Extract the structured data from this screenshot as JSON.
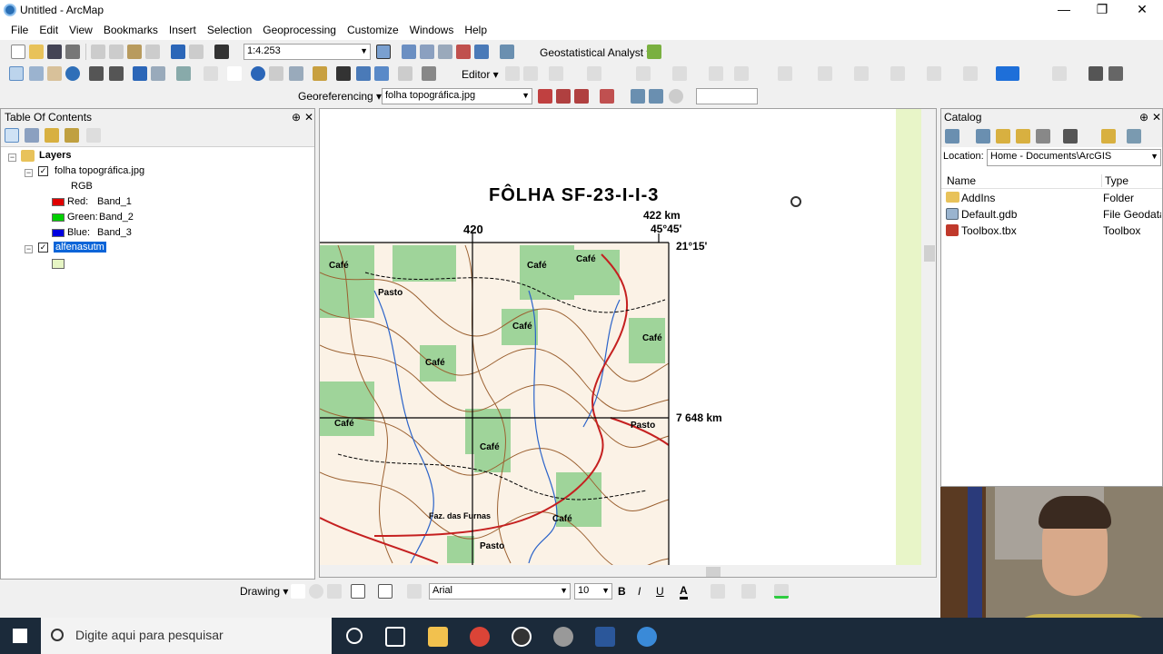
{
  "window": {
    "title": "Untitled - ArcMap",
    "minimize": "—",
    "restore": "❐",
    "close": "✕"
  },
  "menu": [
    "File",
    "Edit",
    "View",
    "Bookmarks",
    "Insert",
    "Selection",
    "Geoprocessing",
    "Customize",
    "Windows",
    "Help"
  ],
  "toolbar": {
    "scale": "1:4.253",
    "geostat": "Geostatistical Analyst ▾",
    "editor": "Editor ▾",
    "georef": "Georeferencing ▾",
    "georef_layer": "folha topográfica.jpg"
  },
  "toc": {
    "title": "Table Of Contents",
    "pin": "⊕",
    "close": "✕",
    "layers_label": "Layers",
    "raster_layer": "folha topográfica.jpg",
    "rgb": "RGB",
    "bands": [
      {
        "label": "Red:",
        "band": "Band_1",
        "color": "#e00000"
      },
      {
        "label": "Green:",
        "band": "Band_2",
        "color": "#00d000"
      },
      {
        "label": "Blue:",
        "band": "Band_3",
        "color": "#0000e0"
      }
    ],
    "vector_layer": "alfenasutm",
    "vector_color": "#e6f5c4"
  },
  "map": {
    "title": "FÔLHA SF-23-I-I-3",
    "easting_420": "420",
    "easting_422": "422 km",
    "lon": "45°45'",
    "lat": "21°15'",
    "northing": "7 648 km",
    "labels": [
      "Café",
      "Pasto",
      "Café",
      "Café",
      "Café",
      "Café",
      "Café",
      "Pasto",
      "Café",
      "Café",
      "Pasto",
      "Faz. das Furnas",
      "Café",
      "Pasto"
    ]
  },
  "catalog": {
    "title": "Catalog",
    "location_label": "Location:",
    "location": "Home - Documents\\ArcGIS",
    "cols": [
      "Name",
      "Type"
    ],
    "items": [
      {
        "name": "AddIns",
        "type": "Folder",
        "icon": "folder-icon"
      },
      {
        "name": "Default.gdb",
        "type": "File Geodata",
        "icon": "geodatabase-icon"
      },
      {
        "name": "Toolbox.tbx",
        "type": "Toolbox",
        "icon": "toolbox-icon"
      }
    ]
  },
  "drawbar": {
    "drawing": "Drawing ▾",
    "font": "Arial",
    "size": "10",
    "bold": "B",
    "italic": "I",
    "underline": "U",
    "font_color": "A"
  },
  "taskbar": {
    "search_placeholder": "Digite aqui para pesquisar"
  }
}
